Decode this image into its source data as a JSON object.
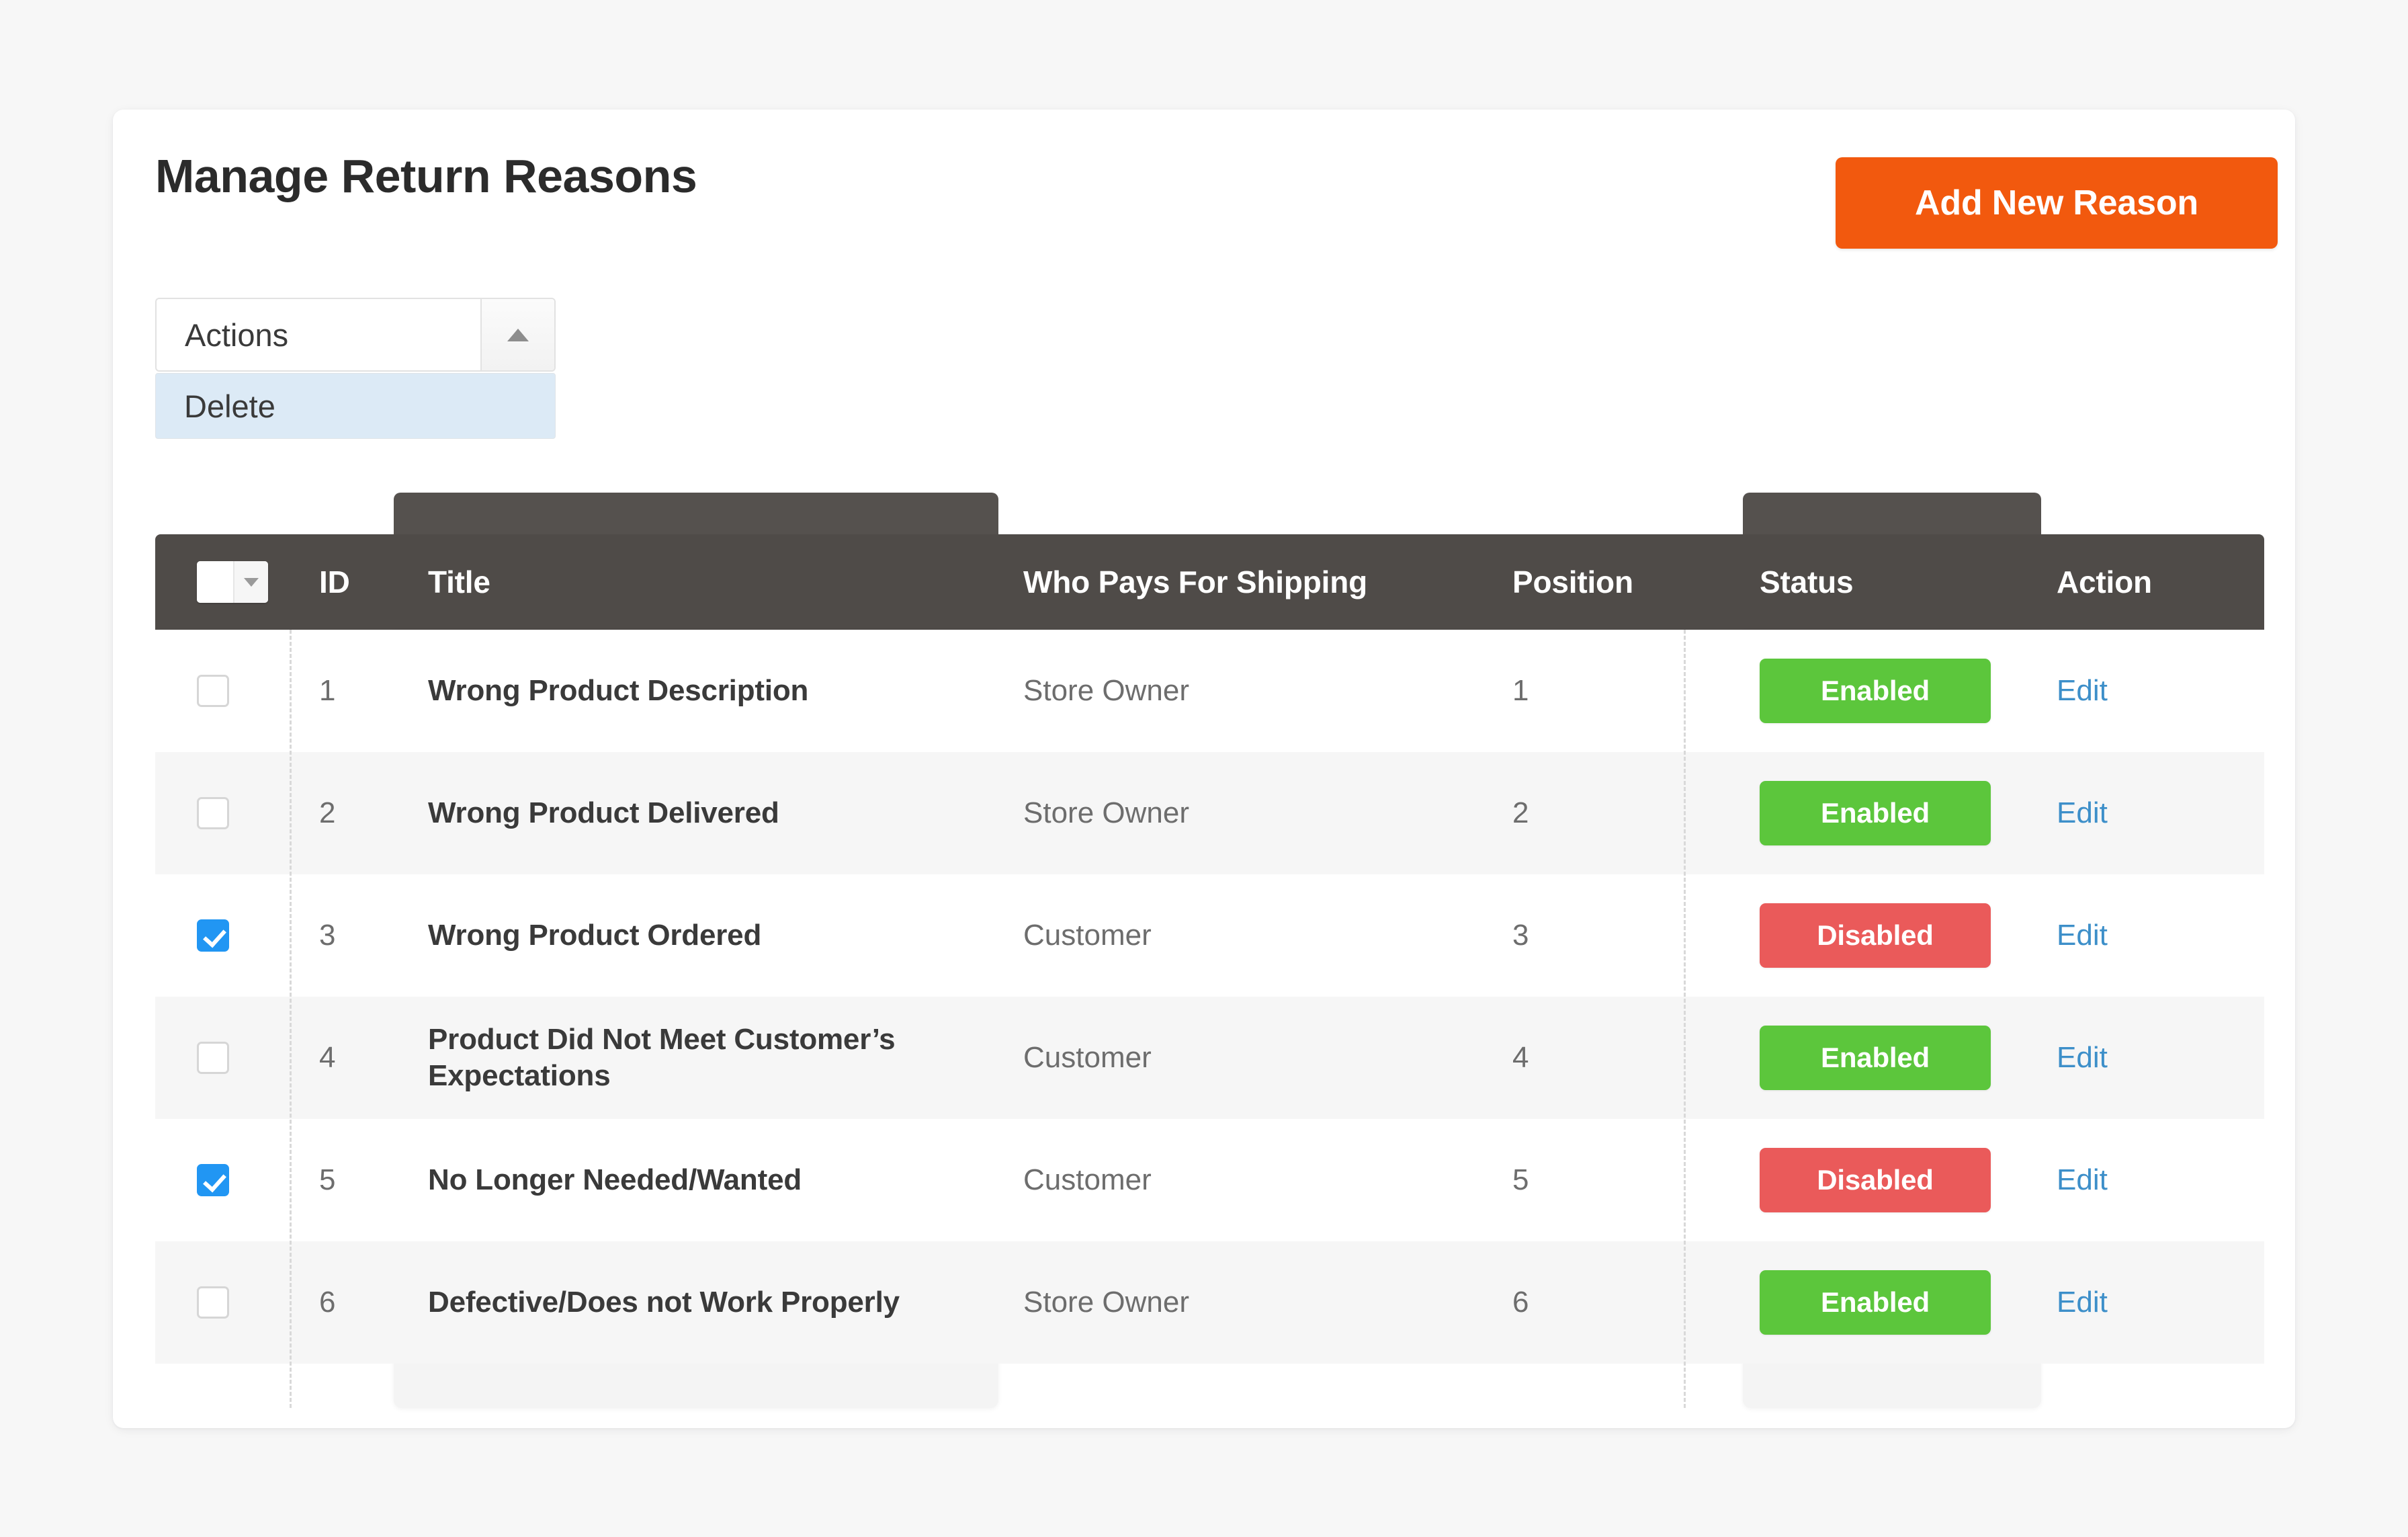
{
  "page": {
    "title": "Manage Return Reasons",
    "add_button_label": "Add New Reason"
  },
  "actions_select": {
    "value": "Actions",
    "caret_icon": "caret-up-icon",
    "options": [
      {
        "label": "Delete",
        "highlighted": true
      }
    ]
  },
  "table": {
    "select_all": {
      "icon": "chevron-down-icon",
      "checked": false
    },
    "columns": [
      {
        "key": "select",
        "label": ""
      },
      {
        "key": "id",
        "label": "ID"
      },
      {
        "key": "title",
        "label": "Title"
      },
      {
        "key": "who_pays",
        "label": "Who Pays For Shipping"
      },
      {
        "key": "position",
        "label": "Position"
      },
      {
        "key": "status",
        "label": "Status"
      },
      {
        "key": "action",
        "label": "Action"
      }
    ],
    "rows": [
      {
        "checked": false,
        "id": "1",
        "title": "Wrong Product Description",
        "who_pays": "Store Owner",
        "position": "1",
        "status": "Enabled",
        "status_state": "enabled",
        "action": "Edit"
      },
      {
        "checked": false,
        "id": "2",
        "title": "Wrong Product Delivered",
        "who_pays": "Store Owner",
        "position": "2",
        "status": "Enabled",
        "status_state": "enabled",
        "action": "Edit"
      },
      {
        "checked": true,
        "id": "3",
        "title": "Wrong Product Ordered",
        "who_pays": "Customer",
        "position": "3",
        "status": "Disabled",
        "status_state": "disabled",
        "action": "Edit"
      },
      {
        "checked": false,
        "id": "4",
        "title": "Product Did Not Meet Customer’s Expectations",
        "who_pays": "Customer",
        "position": "4",
        "status": "Enabled",
        "status_state": "enabled",
        "action": "Edit"
      },
      {
        "checked": true,
        "id": "5",
        "title": "No Longer Needed/Wanted",
        "who_pays": "Customer",
        "position": "5",
        "status": "Disabled",
        "status_state": "disabled",
        "action": "Edit"
      },
      {
        "checked": false,
        "id": "6",
        "title": "Defective/Does not Work Properly",
        "who_pays": "Store Owner",
        "position": "6",
        "status": "Enabled",
        "status_state": "enabled",
        "action": "Edit"
      }
    ]
  },
  "colors": {
    "accent_orange": "#f2590e",
    "header_dark": "#4f4b48",
    "badge_enabled": "#5cc63c",
    "badge_disabled": "#ea5a5a",
    "link_blue": "#3d8fc9",
    "checkbox_blue": "#2196f3",
    "option_highlight": "#dceaf6",
    "page_bg": "#f7f7f7"
  }
}
